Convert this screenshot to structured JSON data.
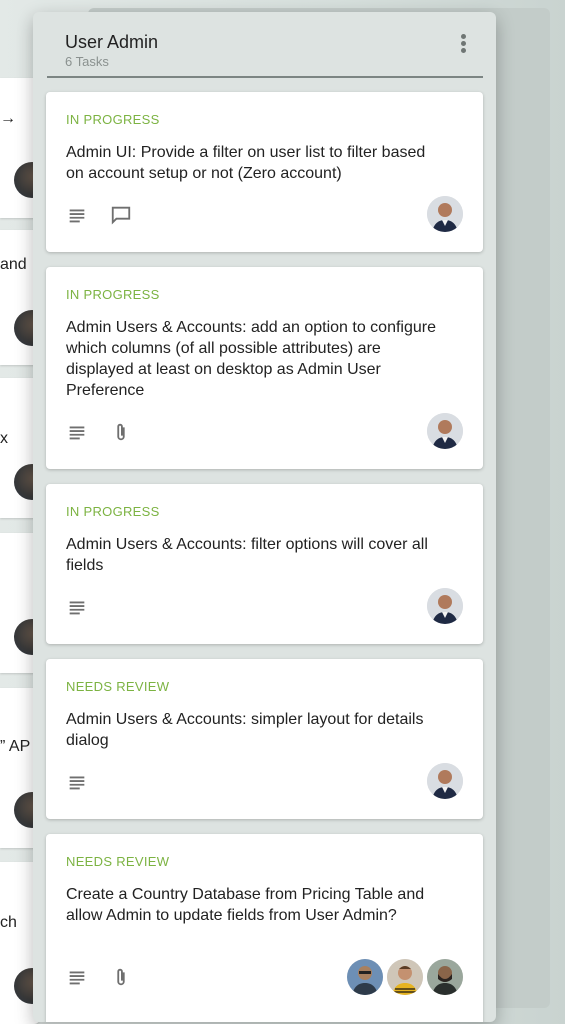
{
  "background": {
    "fragments": [
      "→",
      "and",
      "x",
      "” AP",
      "ch"
    ]
  },
  "column": {
    "title": "User Admin",
    "count": "6 Tasks"
  },
  "cards": [
    {
      "status": "IN PROGRESS",
      "title": "Admin UI: Provide a filter on user list to filter based on account setup or not (Zero account)",
      "icons": [
        "description-icon",
        "comment-icon"
      ],
      "avatars": [
        "avatar-bald-man"
      ]
    },
    {
      "status": "IN PROGRESS",
      "title": "Admin Users & Accounts: add an option to configure which columns (of all possible attributes) are displayed at least on desktop as Admin User Preference",
      "icons": [
        "description-icon",
        "attachment-icon"
      ],
      "avatars": [
        "avatar-bald-man"
      ]
    },
    {
      "status": "IN PROGRESS",
      "title": "Admin Users & Accounts: filter options will cover all fields",
      "icons": [
        "description-icon"
      ],
      "avatars": [
        "avatar-bald-man"
      ]
    },
    {
      "status": "NEEDS REVIEW",
      "title": "Admin Users & Accounts: simpler layout for details dialog",
      "icons": [
        "description-icon"
      ],
      "avatars": [
        "avatar-bald-man"
      ]
    },
    {
      "status": "NEEDS REVIEW",
      "title": "Create a Country Database from Pricing Table and allow Admin to update fields from User Admin?",
      "icons": [
        "description-icon",
        "attachment-icon"
      ],
      "avatars": [
        "avatar-glasses-man",
        "avatar-yellow-shirt-man",
        "avatar-bearded-man"
      ]
    }
  ],
  "colors": {
    "status": "#7cb342",
    "column_bg": "#dde3e1",
    "card_bg": "#ffffff"
  }
}
